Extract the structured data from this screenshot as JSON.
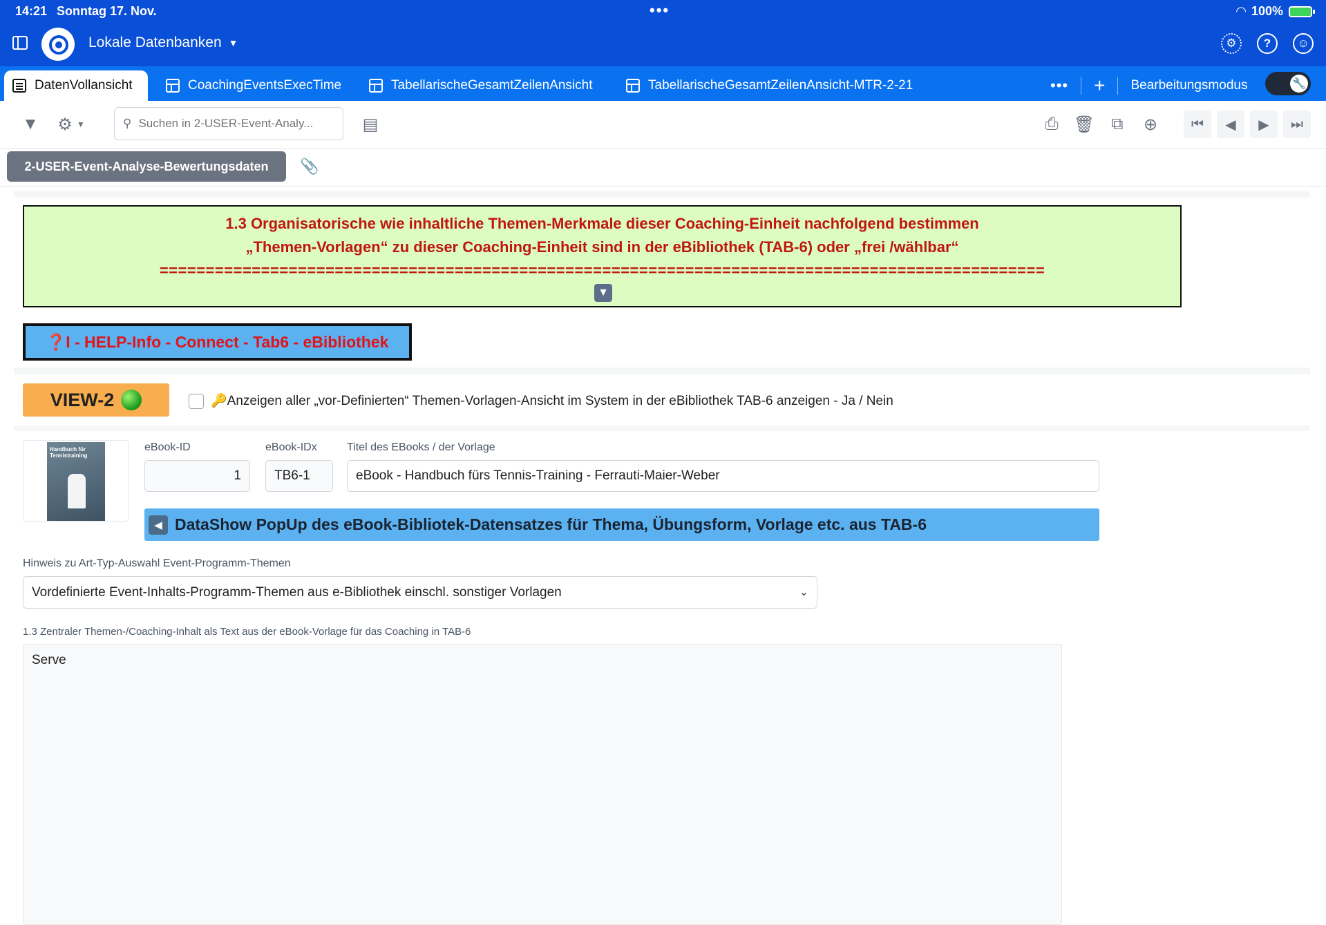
{
  "status_bar": {
    "time": "14:21",
    "date": "Sonntag 17. Nov.",
    "battery": "100%"
  },
  "app": {
    "db_selector": "Lokale Datenbanken",
    "accent": "#0a4fd8"
  },
  "tabs": [
    {
      "label": "DatenVollansicht",
      "active": true
    },
    {
      "label": "CoachingEventsExecTime",
      "active": false
    },
    {
      "label": "TabellarischeGesamtZeilenAnsicht",
      "active": false
    },
    {
      "label": "TabellarischeGesamtZeilenAnsicht-MTR-2-21",
      "active": false
    }
  ],
  "edit_mode": {
    "label": "Bearbeitungsmodus"
  },
  "toolbar": {
    "search_placeholder": "Suchen in 2-USER-Event-Analy..."
  },
  "record_tab": {
    "label": "2-USER-Event-Analyse-Bewertungsdaten"
  },
  "header_box": {
    "line1": "1.3   Organisatorische wie inhaltliche Themen-Merkmale dieser Coaching-Einheit nachfolgend  bestimmen",
    "line2": "„Themen-Vorlagen“  zu dieser Coaching-Einheit sind in der eBibliothek (TAB-6) oder „frei /wählbar“",
    "line3": "================================================================================================",
    "bg": "#dcfcc2",
    "text_color": "#c0170f"
  },
  "help_button": {
    "label": "❓I - HELP-Info - Connect - Tab6 - eBibliothek"
  },
  "view_badge": {
    "label": "VIEW-2"
  },
  "show_all_checkbox": {
    "label": "🔑Anzeigen aller „vor-Definierten“ Themen-Vorlagen-Ansicht im System in der eBibliothek TAB-6 anzeigen - Ja / Nein",
    "checked": false
  },
  "book": {
    "cover_title": "Handbuch für Tennistraining",
    "ebook_id_label": "eBook-ID",
    "ebook_id": "1",
    "ebook_idx_label": "eBook-IDx",
    "ebook_idx": "TB6-1",
    "title_label": "Titel des EBooks / der Vorlage",
    "title": "eBook - Handbuch fürs Tennis-Training - Ferrauti-Maier-Weber"
  },
  "popup_button": {
    "label": "DataShow PopUp des eBook-Bibliotek-Datensatzes für Thema, Übungsform, Vorlage etc. aus TAB-6"
  },
  "hint_select": {
    "label": "Hinweis zu Art-Typ-Auswahl Event-Programm-Themen",
    "value": "Vordefinierte Event-Inhalts-Programm-Themen aus e-Bibliothek einschl. sonstiger Vorlagen"
  },
  "central_text": {
    "label": "1.3 Zentraler Themen-/Coaching-Inhalt als Text aus der eBook-Vorlage für das Coaching in TAB-6",
    "value": "Serve"
  }
}
